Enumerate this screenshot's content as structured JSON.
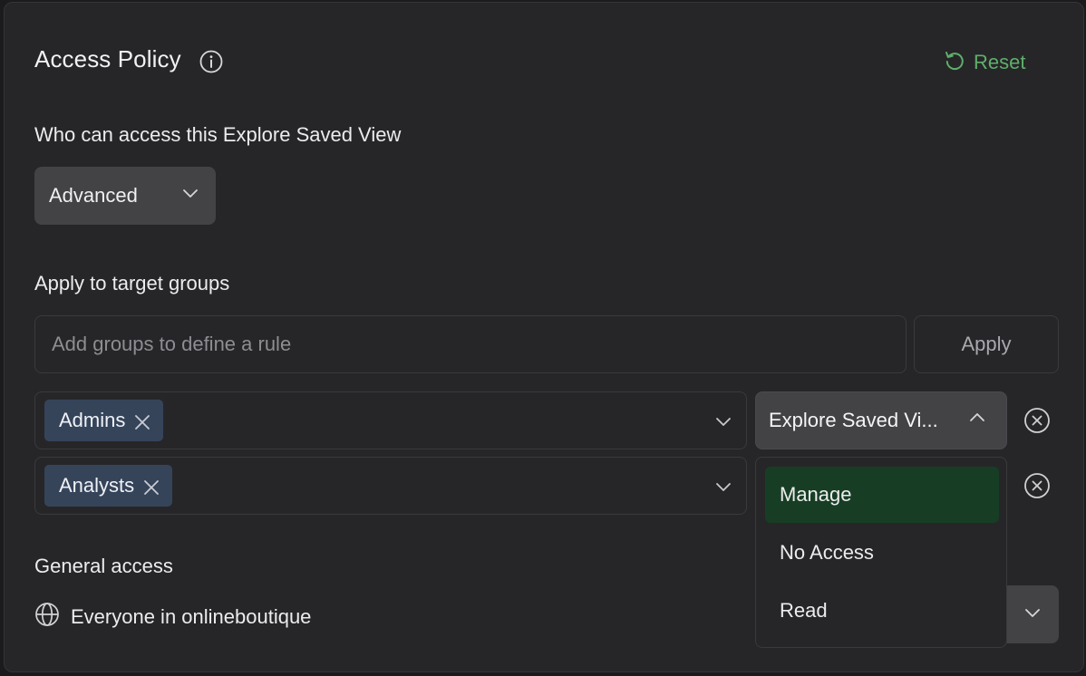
{
  "header": {
    "title": "Access Policy",
    "reset_label": "Reset"
  },
  "access": {
    "label": "Who can access this Explore Saved View",
    "mode": "Advanced"
  },
  "target_groups": {
    "label": "Apply to target groups",
    "input_placeholder": "Add groups to define a rule",
    "apply_label": "Apply",
    "rules": [
      {
        "group": "Admins",
        "permission": "Explore Saved Vi..."
      },
      {
        "group": "Analysts",
        "permission": ""
      }
    ]
  },
  "permission_dropdown": {
    "options": [
      "Manage",
      "No Access",
      "Read"
    ],
    "selected": "Manage"
  },
  "general_access": {
    "label": "General access",
    "scope": "Everyone in onlineboutique"
  },
  "colors": {
    "accent_green": "#5fae6c",
    "selected_bg": "#173e24",
    "chip_bg": "#36445a"
  }
}
